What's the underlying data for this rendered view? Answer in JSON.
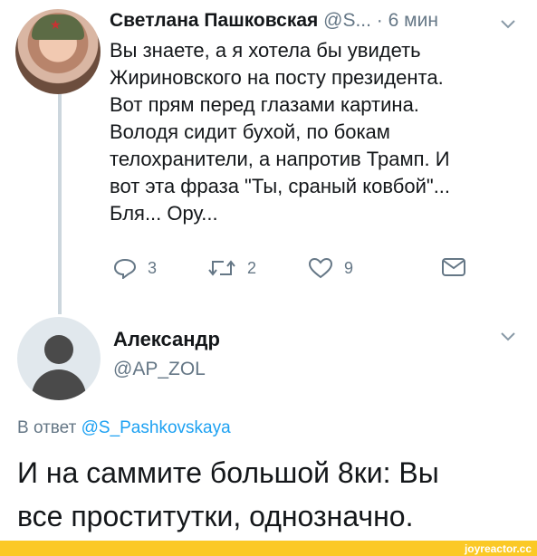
{
  "tweet": {
    "name": "Светлана Пашковская",
    "handle": "@S...",
    "separator": "·",
    "time": "6 мин",
    "lines": [
      "Вы знаете, а я хотела бы увидеть",
      "Жириновского на посту президента.",
      "Вот прям перед глазами картина.",
      "Володя сидит бухой, по бокам",
      "телохранители, а напротив Трамп. И",
      "вот эта фраза \"Ты, сраный ковбой\"...",
      "Бля... Ору..."
    ],
    "actions": {
      "reply_count": "3",
      "retweet_count": "2",
      "like_count": "9"
    },
    "icons": [
      "reply-icon",
      "retweet-icon",
      "like-icon",
      "message-icon",
      "chevron-down-icon"
    ]
  },
  "reply": {
    "name": "Александр",
    "handle": "@AP_ZOL",
    "reply_prefix": "В ответ",
    "reply_to": "@S_Pashkovskaya",
    "lines": [
      "И на саммите большой 8ки: Вы",
      "все проститутки, однозначно."
    ]
  },
  "watermark": "joyreactor.cc",
  "colors": {
    "text": "#14171a",
    "secondary": "#657786",
    "link": "#1da1f2",
    "thread_line": "#ccd6dd",
    "watermark_bar": "#fbc926"
  }
}
